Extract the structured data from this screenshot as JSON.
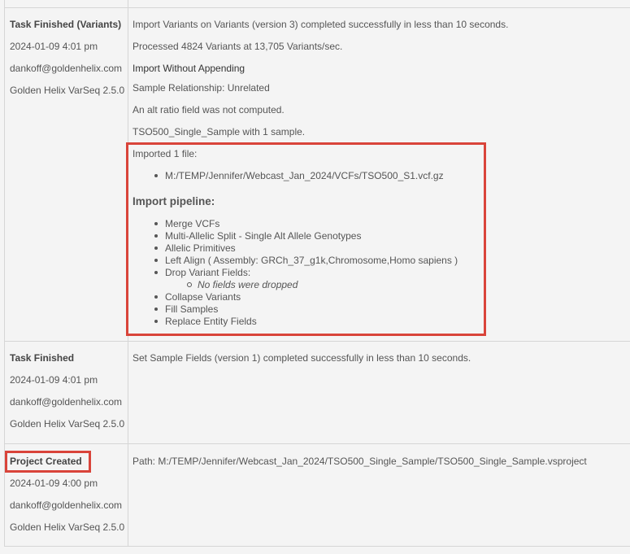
{
  "entries": [
    {
      "task": "Task Finished (Variants)",
      "date": "2024-01-09 4:01 pm",
      "user": "dankoff@goldenhelix.com",
      "app": "Golden Helix VarSeq 2.5.0",
      "lines": [
        "Import Variants on Variants (version 3) completed successfully in less than 10 seconds.",
        "Processed 4824 Variants at 13,705 Variants/sec.",
        "Import Without Appending",
        "Sample Relationship: Unrelated",
        "An alt ratio field was not computed.",
        "TSO500_Single_Sample with 1 sample."
      ],
      "imported_label": "Imported 1 file:",
      "imported_files": [
        "M:/TEMP/Jennifer/Webcast_Jan_2024/VCFs/TSO500_S1.vcf.gz"
      ],
      "pipeline_title": "Import pipeline:",
      "pipeline": [
        "Merge VCFs",
        "Multi-Allelic Split - Single Alt Allele Genotypes",
        "Allelic Primitives",
        "Left Align ( Assembly: GRCh_37_g1k,Chromosome,Homo sapiens )",
        "Drop Variant Fields:",
        "Collapse Variants",
        "Fill Samples",
        "Replace Entity Fields"
      ],
      "drop_fields_note": "No fields were dropped"
    },
    {
      "task": "Task Finished",
      "date": "2024-01-09 4:01 pm",
      "user": "dankoff@goldenhelix.com",
      "app": "Golden Helix VarSeq 2.5.0",
      "lines": [
        "Set Sample Fields (version 1) completed successfully in less than 10 seconds."
      ]
    },
    {
      "task": "Project Created",
      "date": "2024-01-09 4:00 pm",
      "user": "dankoff@goldenhelix.com",
      "app": "Golden Helix VarSeq 2.5.0",
      "lines": [
        "Path: M:/TEMP/Jennifer/Webcast_Jan_2024/TSO500_Single_Sample/TSO500_Single_Sample.vsproject"
      ]
    }
  ],
  "colors": {
    "highlight": "#d9443a",
    "border": "#d6d6d6",
    "background": "#f4f4f4"
  }
}
